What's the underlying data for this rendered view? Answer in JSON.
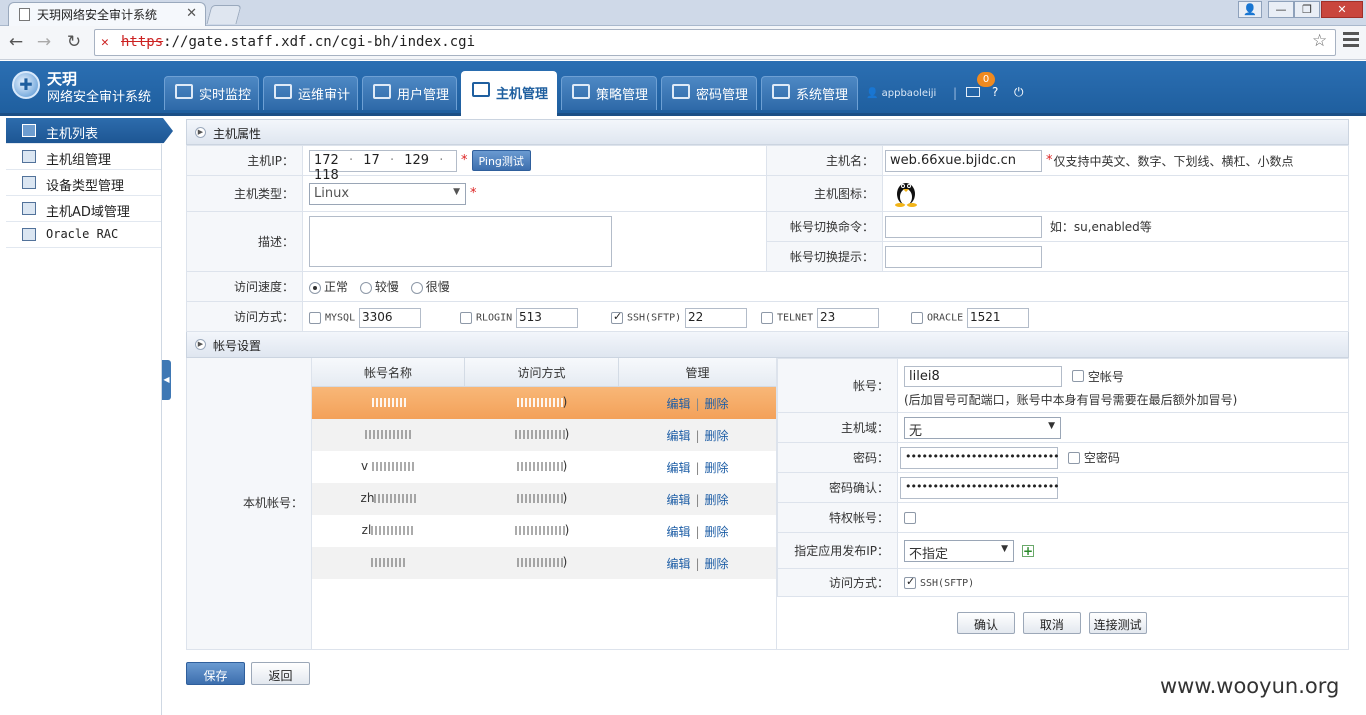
{
  "browser": {
    "tab_title": "天玥网络安全审计系统",
    "url_scheme": "https",
    "url_rest": "://gate.staff.xdf.cn/cgi-bh/index.cgi"
  },
  "header": {
    "logo_line1": "天玥",
    "logo_line2": "网络安全审计系统",
    "tabs": [
      {
        "label": "实时监控"
      },
      {
        "label": "运维审计"
      },
      {
        "label": "用户管理"
      },
      {
        "label": "主机管理"
      },
      {
        "label": "策略管理"
      },
      {
        "label": "密码管理"
      },
      {
        "label": "系统管理"
      }
    ],
    "user": "appbaoleiji",
    "separator": "|",
    "mail_badge": "0",
    "help": "?",
    "exit": "⏻"
  },
  "sidebar": {
    "items": [
      {
        "label": "主机列表"
      },
      {
        "label": "主机组管理"
      },
      {
        "label": "设备类型管理"
      },
      {
        "label": "主机AD域管理"
      },
      {
        "label": "Oracle RAC"
      }
    ]
  },
  "host_props": {
    "section_title": "主机属性",
    "ip_label": "主机IP：",
    "ip": [
      "172",
      "17",
      "129",
      "118"
    ],
    "ip_dot": "·",
    "ping_button": "Ping测试",
    "hostname_label": "主机名：",
    "hostname": "web.66xue.bjidc.cn",
    "hostname_hint": "仅支持中英文、数字、下划线、横杠、小数点",
    "type_label": "主机类型：",
    "type_value": "Linux",
    "icon_label": "主机图标：",
    "desc_label": "描述：",
    "switch_cmd_label": "帐号切换命令：",
    "switch_cmd_hint": "如：su,enabled等",
    "switch_prompt_label": "帐号切换提示：",
    "speed_label": "访问速度：",
    "speed_options": [
      "正常",
      "较慢",
      "很慢"
    ],
    "access_label": "访问方式：",
    "access_methods": [
      {
        "name": "MYSQL",
        "port": "3306",
        "checked": false
      },
      {
        "name": "RLOGIN",
        "port": "513",
        "checked": false
      },
      {
        "name": "SSH(SFTP)",
        "port": "22",
        "checked": true
      },
      {
        "name": "TELNET",
        "port": "23",
        "checked": false
      },
      {
        "name": "ORACLE",
        "port": "1521",
        "checked": false
      }
    ],
    "required_mark": "*"
  },
  "accounts": {
    "section_title": "帐号设置",
    "local_label": "本机帐号：",
    "columns": [
      "帐号名称",
      "访问方式",
      "管理"
    ],
    "row_edit": "编辑",
    "row_delete": "删除",
    "row_pipe": "|",
    "rows": [
      {
        "name_visible": "",
        "paren": ")"
      },
      {
        "name_visible": "",
        "paren": ")"
      },
      {
        "name_visible": "v",
        "paren": ")"
      },
      {
        "name_visible": "zh",
        "paren": ")"
      },
      {
        "name_visible": "zl",
        "paren": ")"
      },
      {
        "name_visible": "",
        "paren": ")"
      }
    ],
    "form": {
      "account_label": "帐号：",
      "account_value": "lilei8",
      "empty_account": "空帐号",
      "account_note": "(后加冒号可配端口，账号中本身有冒号需要在最后额外加冒号)",
      "domain_label": "主机域：",
      "domain_value": "无",
      "password_label": "密码：",
      "password_value": "••••••••••••••••••••••••••••",
      "empty_password": "空密码",
      "confirm_label": "密码确认：",
      "confirm_value": "••••••••••••••••••••••••••••",
      "privileged_label": "特权帐号：",
      "publish_ip_label": "指定应用发布IP：",
      "publish_ip_value": "不指定",
      "access_label": "访问方式：",
      "access_value": "SSH(SFTP)",
      "confirm_button": "确认",
      "cancel_button": "取消",
      "test_button": "连接测试"
    }
  },
  "footer": {
    "save_button": "保存",
    "back_button": "返回",
    "watermark": "www.wooyun.org"
  }
}
